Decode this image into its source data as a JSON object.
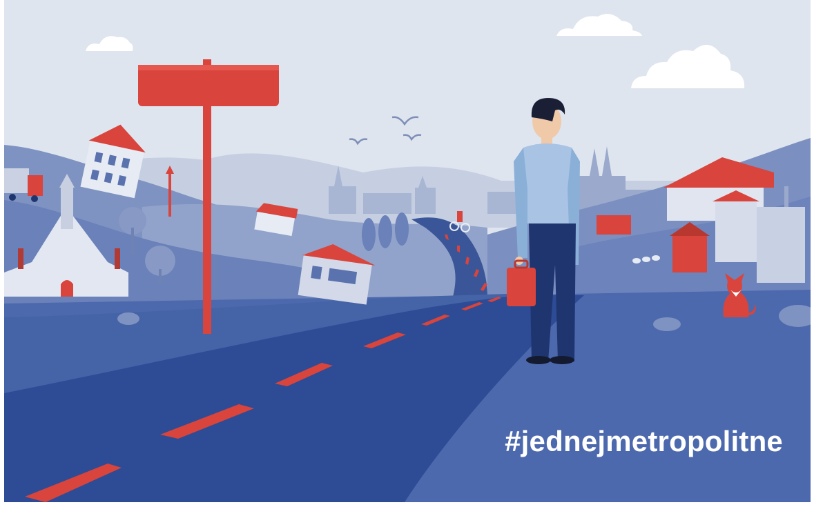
{
  "poster": {
    "hashtag": "#jednejmetropolitne",
    "colors": {
      "sky": "#dfe5ee",
      "hills": "#8c9ec8",
      "ground": "#4563a7",
      "road": "#2d4c95",
      "accent_red": "#d9443c",
      "shirt": "#8ab0d8",
      "trousers": "#1f3570"
    },
    "icons": [
      "cloud",
      "signpost",
      "house",
      "church",
      "city-skyline",
      "birds",
      "truck",
      "street-lamp",
      "tree",
      "cyclist",
      "man-with-briefcase",
      "fox",
      "ducks",
      "vineyard"
    ]
  }
}
